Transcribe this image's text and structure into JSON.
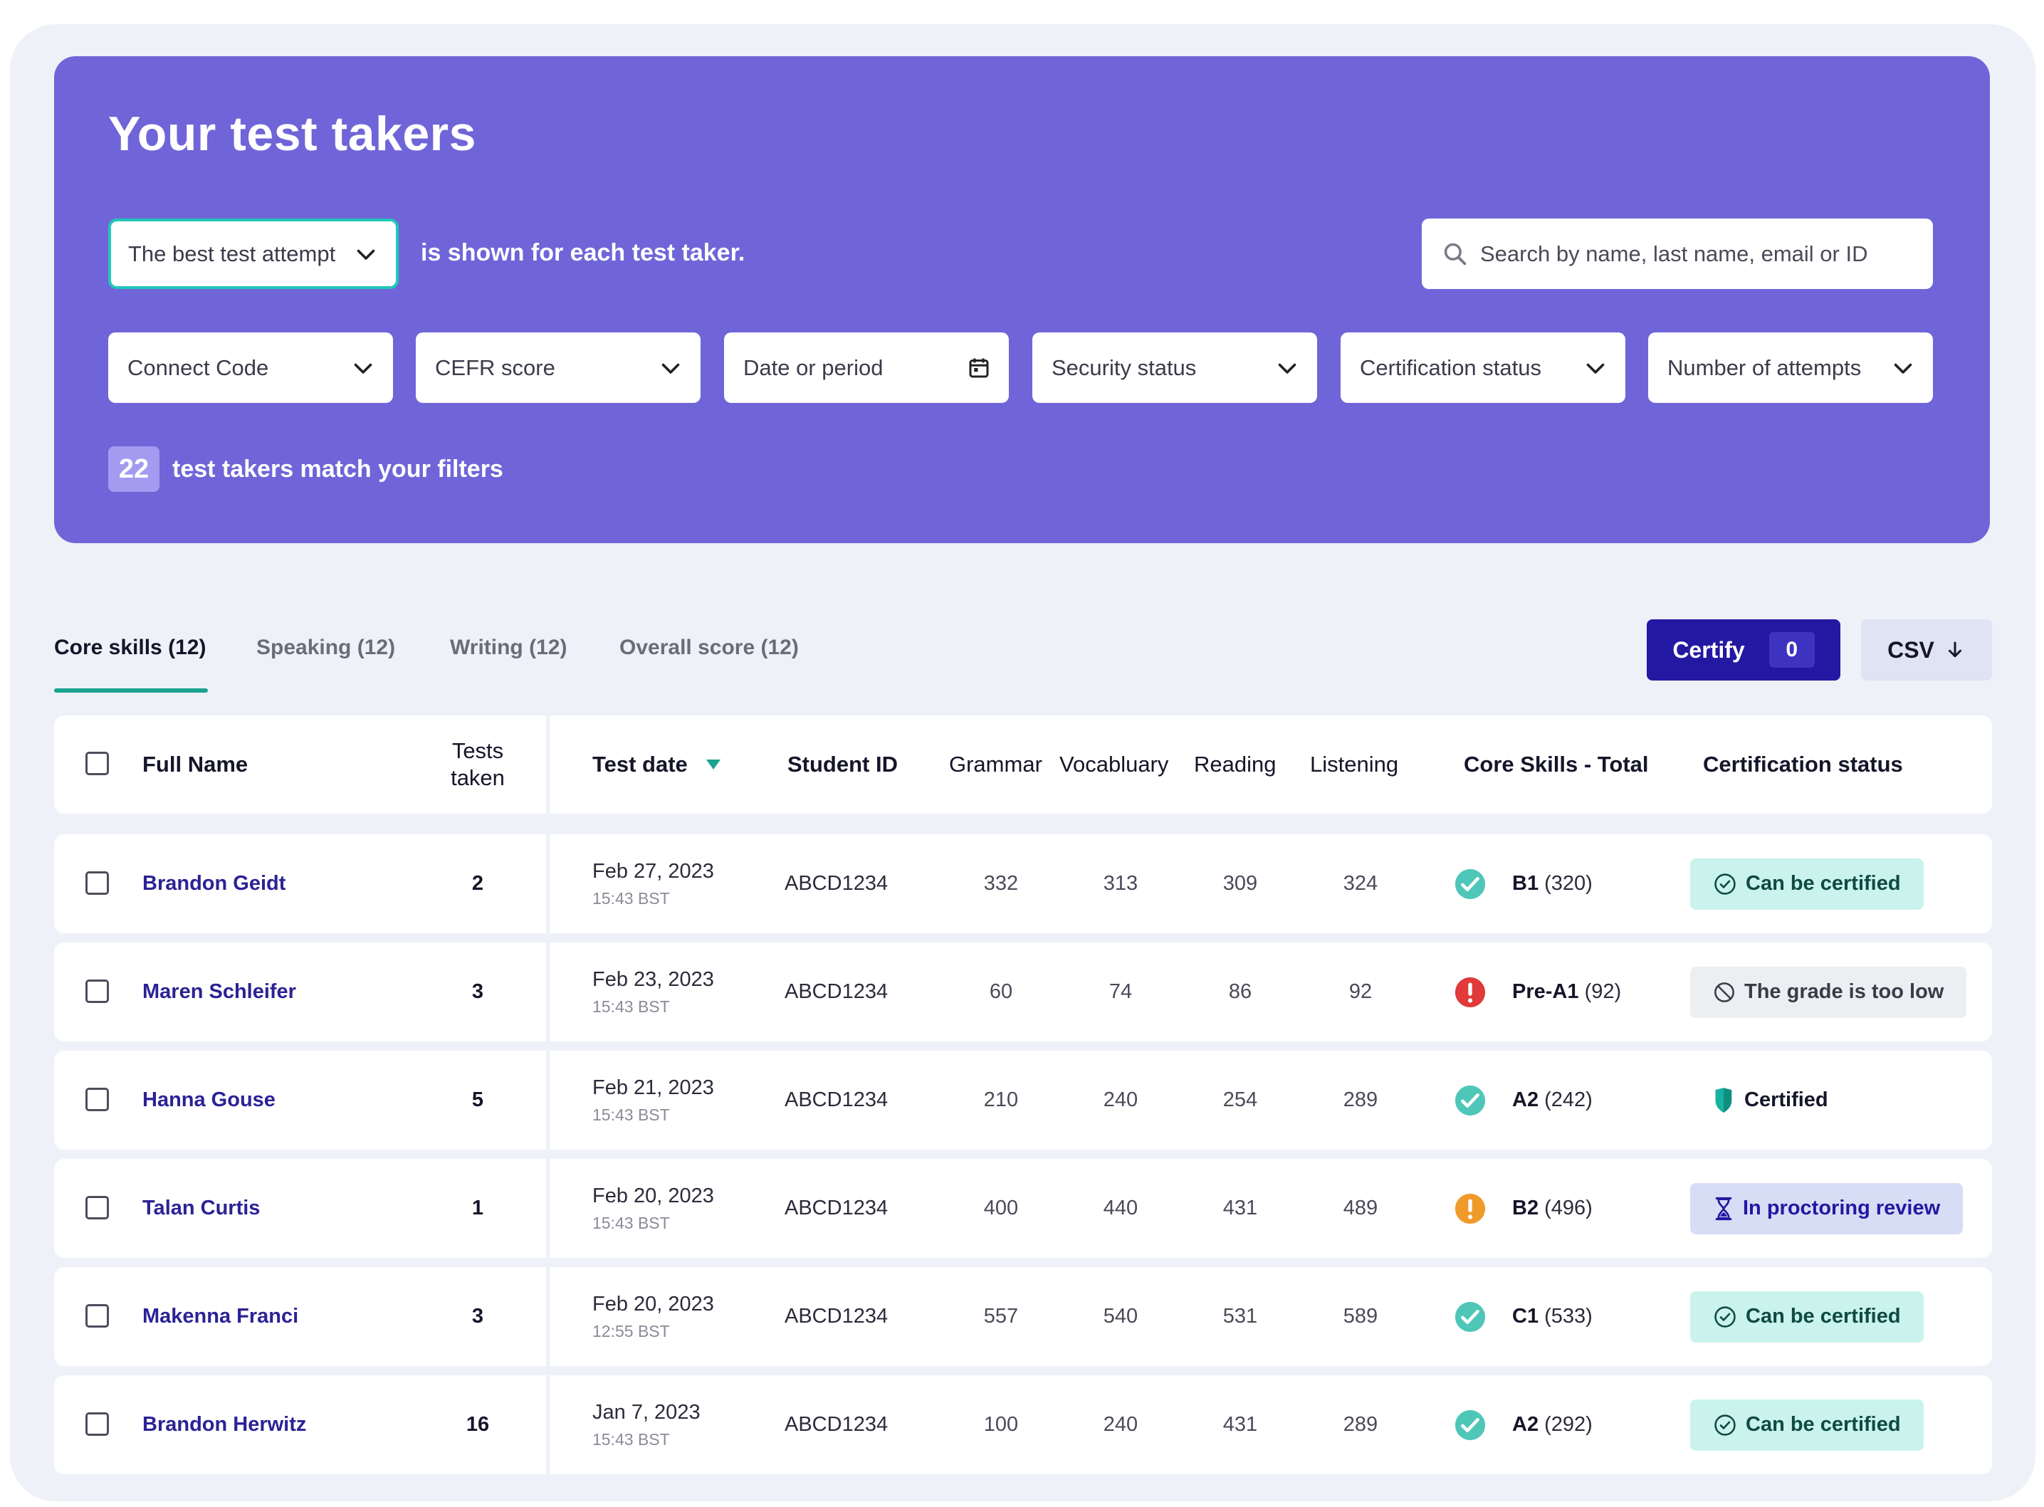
{
  "hero": {
    "title": "Your test takers",
    "attempt_select": "The best test attempt",
    "shown_text": "is shown for each test taker.",
    "search_placeholder": "Search by name, last name, email or ID",
    "filters": [
      "Connect Code",
      "CEFR score",
      "Date or period",
      "Security status",
      "Certification status",
      "Number of attempts"
    ],
    "match_count": "22",
    "match_text": "test takers match your filters"
  },
  "tabs": [
    {
      "label": "Core skills (12)",
      "active": true
    },
    {
      "label": "Speaking (12)",
      "active": false
    },
    {
      "label": "Writing (12)",
      "active": false
    },
    {
      "label": "Overall score (12)",
      "active": false
    }
  ],
  "actions": {
    "certify_label": "Certify",
    "certify_count": "0",
    "csv_label": "CSV"
  },
  "table": {
    "headers": {
      "full_name": "Full Name",
      "tests_taken_1": "Tests",
      "tests_taken_2": "taken",
      "test_date": "Test date",
      "student_id": "Student ID",
      "grammar": "Grammar",
      "vocabulary": "Vocabluary",
      "reading": "Reading",
      "listening": "Listening",
      "core_total": "Core Skills - Total",
      "cert_status": "Certification status"
    },
    "rows": [
      {
        "name": "Brandon Geidt",
        "taken": "2",
        "date": "Feb 27, 2023",
        "time": "15:43 BST",
        "sid": "ABCD1234",
        "grammar": "332",
        "vocabulary": "313",
        "reading": "309",
        "listening": "324",
        "level": "B1",
        "score": "(320)",
        "level_icon": "check-icon",
        "cert": "Can be certified",
        "cert_icon": "check-circle-icon",
        "cert_style": "green"
      },
      {
        "name": "Maren Schleifer",
        "taken": "3",
        "date": "Feb 23, 2023",
        "time": "15:43 BST",
        "sid": "ABCD1234",
        "grammar": "60",
        "vocabulary": "74",
        "reading": "86",
        "listening": "92",
        "level": "Pre-A1",
        "score": "(92)",
        "level_icon": "error-icon",
        "cert": "The grade is too low",
        "cert_icon": "blocked-icon",
        "cert_style": "grey"
      },
      {
        "name": "Hanna Gouse",
        "taken": "5",
        "date": "Feb 21, 2023",
        "time": "15:43 BST",
        "sid": "ABCD1234",
        "grammar": "210",
        "vocabulary": "240",
        "reading": "254",
        "listening": "289",
        "level": "A2",
        "score": "(242)",
        "level_icon": "check-icon",
        "cert": "Certified",
        "cert_icon": "shield-icon",
        "cert_style": "plain"
      },
      {
        "name": "Talan Curtis",
        "taken": "1",
        "date": "Feb 20, 2023",
        "time": "15:43 BST",
        "sid": "ABCD1234",
        "grammar": "400",
        "vocabulary": "440",
        "reading": "431",
        "listening": "489",
        "level": "B2",
        "score": "(496)",
        "level_icon": "warning-icon",
        "cert": "In proctoring review",
        "cert_icon": "hourglass-icon",
        "cert_style": "blue"
      },
      {
        "name": "Makenna Franci",
        "taken": "3",
        "date": "Feb 20, 2023",
        "time": "12:55 BST",
        "sid": "ABCD1234",
        "grammar": "557",
        "vocabulary": "540",
        "reading": "531",
        "listening": "589",
        "level": "C1",
        "score": "(533)",
        "level_icon": "check-icon",
        "cert": "Can be certified",
        "cert_icon": "check-circle-icon",
        "cert_style": "green"
      },
      {
        "name": "Brandon Herwitz",
        "taken": "16",
        "date": "Jan 7, 2023",
        "time": "15:43 BST",
        "sid": "ABCD1234",
        "grammar": "100",
        "vocabulary": "240",
        "reading": "431",
        "listening": "289",
        "level": "A2",
        "score": "(292)",
        "level_icon": "check-icon",
        "cert": "Can be certified",
        "cert_icon": "check-circle-icon",
        "cert_style": "green"
      }
    ]
  },
  "colors": {
    "hero": "#6f65d8",
    "accent_teal": "#1aa38e",
    "primary": "#2318a2",
    "ok": "#4fc7b8",
    "error": "#e03a3a",
    "warning": "#f09a2a"
  }
}
